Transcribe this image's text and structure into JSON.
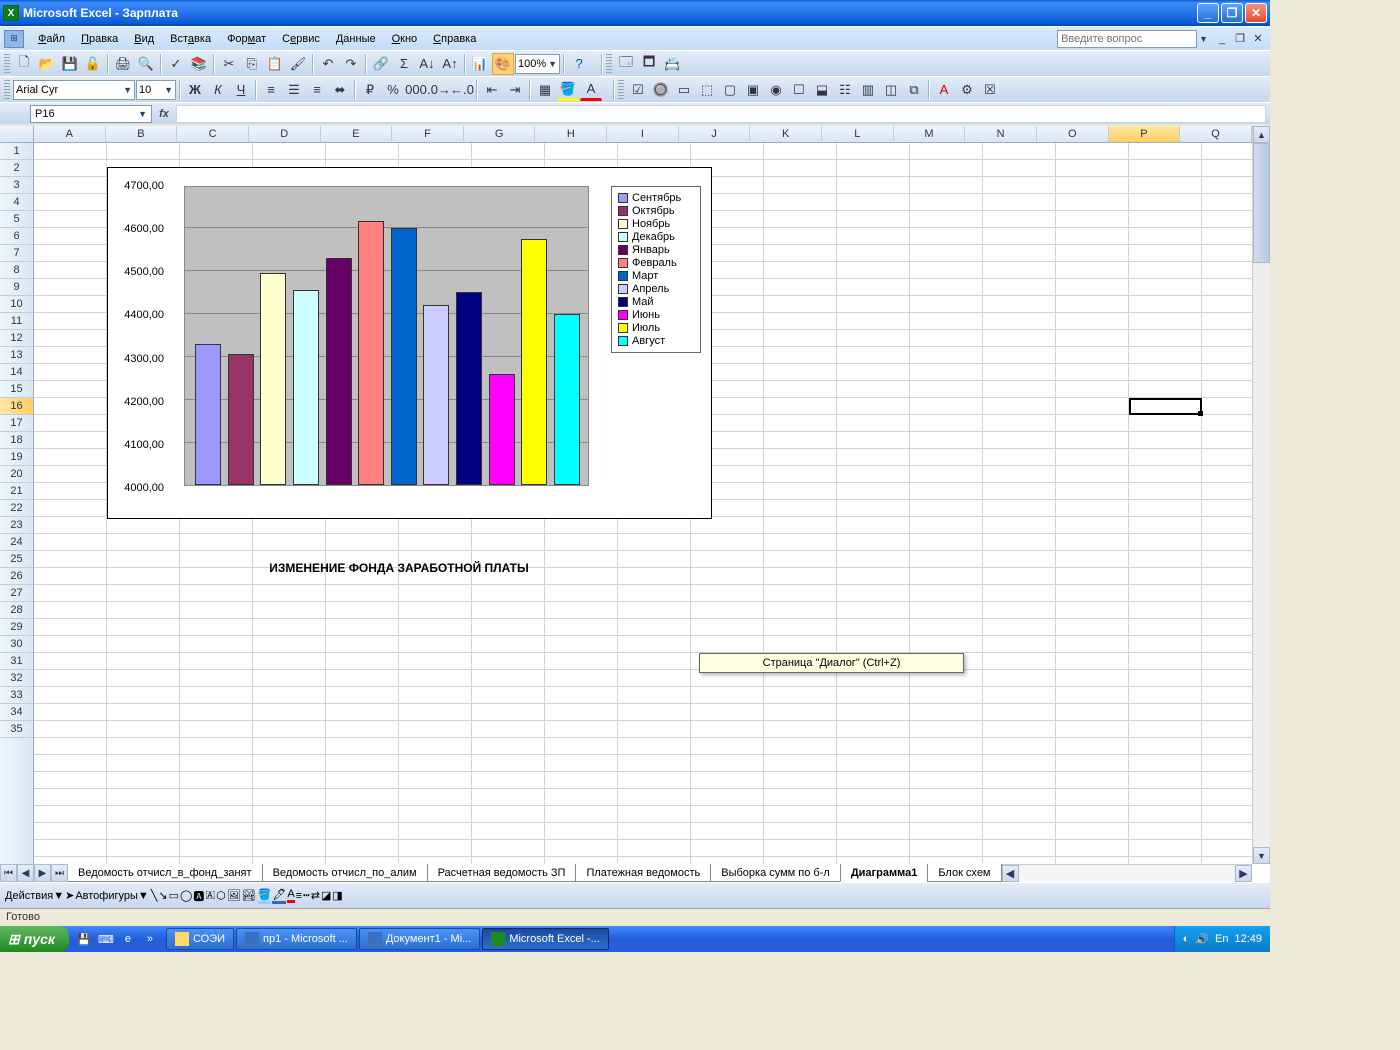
{
  "titlebar": {
    "title": "Microsoft Excel - Зарплата"
  },
  "menubar": {
    "items": [
      "Файл",
      "Правка",
      "Вид",
      "Вставка",
      "Формат",
      "Сервис",
      "Данные",
      "Окно",
      "Справка"
    ],
    "ask_placeholder": "Введите вопрос"
  },
  "formatting": {
    "font_name": "Arial Cyr",
    "font_size": "10"
  },
  "toolbar_zoom": "100%",
  "namebox": "P16",
  "columns": [
    "A",
    "B",
    "C",
    "D",
    "E",
    "F",
    "G",
    "H",
    "I",
    "J",
    "K",
    "L",
    "M",
    "N",
    "O",
    "P",
    "Q"
  ],
  "sel_col": "P",
  "sel_row": 16,
  "row_count": 35,
  "chart": {
    "title": "ИЗМЕНЕНИЕ ФОНДА ЗАРАБОТНОЙ ПЛАТЫ",
    "yticks": [
      "4000,00",
      "4100,00",
      "4200,00",
      "4300,00",
      "4400,00",
      "4500,00",
      "4600,00",
      "4700,00"
    ],
    "legend": [
      {
        "label": "Сентябрь",
        "color": "#9999ff"
      },
      {
        "label": "Октябрь",
        "color": "#993366"
      },
      {
        "label": "Ноябрь",
        "color": "#ffffcc"
      },
      {
        "label": "Декабрь",
        "color": "#ccffff"
      },
      {
        "label": "Январь",
        "color": "#660066"
      },
      {
        "label": "Февраль",
        "color": "#ff8080"
      },
      {
        "label": "Март",
        "color": "#0066cc"
      },
      {
        "label": "Апрель",
        "color": "#ccccff"
      },
      {
        "label": "Май",
        "color": "#000080"
      },
      {
        "label": "Июнь",
        "color": "#ff00ff"
      },
      {
        "label": "Июль",
        "color": "#ffff00"
      },
      {
        "label": "Август",
        "color": "#00ffff"
      }
    ]
  },
  "chart_data": {
    "type": "bar",
    "categories": [
      "Сентябрь",
      "Октябрь",
      "Ноябрь",
      "Декабрь",
      "Январь",
      "Февраль",
      "Март",
      "Апрель",
      "Май",
      "Июнь",
      "Июль",
      "Август"
    ],
    "values": [
      4330,
      4305,
      4495,
      4455,
      4530,
      4615,
      4600,
      4420,
      4450,
      4260,
      4575,
      4400
    ],
    "ylim": [
      4000,
      4700
    ],
    "ylabel": "",
    "xlabel": "",
    "title": "ИЗМЕНЕНИЕ ФОНДА ЗАРАБОТНОЙ ПЛАТЫ"
  },
  "tooltip": "Страница \"Диалог\" (Ctrl+Z)",
  "sheet_tabs": [
    "Ведомость отчисл_в_фонд_занят",
    "Ведомость отчисл_по_алим",
    "Расчетная ведомость ЗП",
    "Платежная ведомость",
    "Выборка сумм по б-л",
    "Диаграмма1",
    "Блок схем"
  ],
  "active_tab": "Диаграмма1",
  "drawbar": {
    "actions_label": "Действия",
    "autoshapes_label": "Автофигуры"
  },
  "status": "Готово",
  "taskbar": {
    "start": "пуск",
    "tasks": [
      {
        "label": "СОЭИ",
        "icon": "folder"
      },
      {
        "label": "пр1 - Microsoft ...",
        "icon": "word"
      },
      {
        "label": "Документ1 - Mi...",
        "icon": "word"
      },
      {
        "label": "Microsoft Excel -...",
        "icon": "excel",
        "active": true
      }
    ],
    "lang": "En",
    "time": "12:49"
  }
}
